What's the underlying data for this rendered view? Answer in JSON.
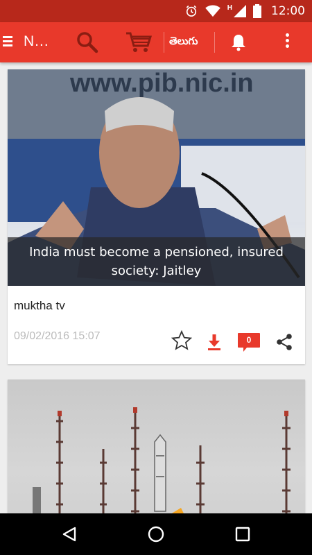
{
  "status_bar": {
    "time": "12:00",
    "network_letter": "H"
  },
  "app_bar": {
    "title": "N...",
    "language_button": "తెలుగు"
  },
  "articles": [
    {
      "caption": "India must become a pensioned, insured society: Jaitley",
      "photo_text": "www.pib.nic.in",
      "source": "muktha tv",
      "timestamp": "09/02/2016 15:07",
      "comment_count": "0"
    }
  ],
  "colors": {
    "status_bar": "#b7281b",
    "app_bar": "#e8392b",
    "accent_red": "#e8392b"
  },
  "icons": [
    "menu-icon",
    "search-icon",
    "cart-icon",
    "bell-icon",
    "more-vert-icon",
    "star-icon",
    "download-icon",
    "comment-icon",
    "share-icon",
    "back-icon",
    "home-icon",
    "recent-apps-icon"
  ]
}
